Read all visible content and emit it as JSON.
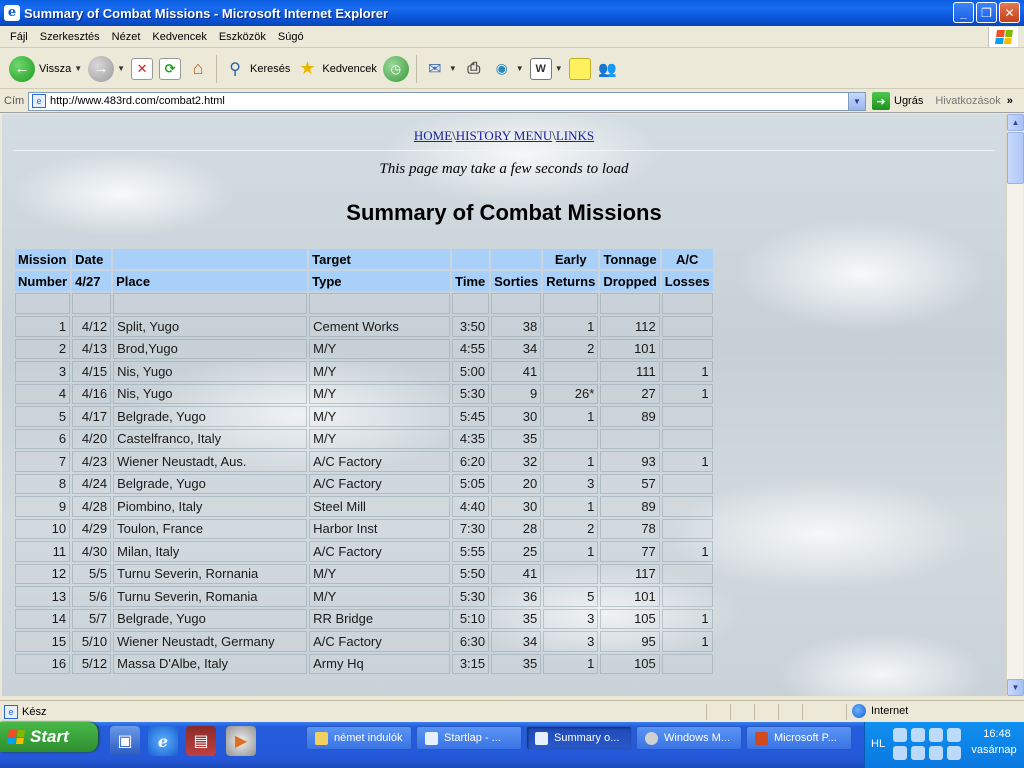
{
  "window": {
    "title": "Summary of Combat Missions - Microsoft Internet Explorer"
  },
  "menu": [
    "Fájl",
    "Szerkesztés",
    "Nézet",
    "Kedvencek",
    "Eszközök",
    "Súgó"
  ],
  "toolbar": {
    "back_label": "Vissza",
    "search_label": "Keresés",
    "favorites_label": "Kedvencek"
  },
  "address": {
    "label": "Cím",
    "url": "http://www.483rd.com/combat2.html",
    "go_label": "Ugrás",
    "links_label": "Hivatkozások"
  },
  "page": {
    "nav": {
      "home": "HOME",
      "history": "HISTORY MENU",
      "links": "LINKS",
      "sep": "\\"
    },
    "load_note": "This page may take a few seconds to load",
    "title": "Summary of Combat Missions",
    "headers_top": [
      "Mission",
      "Date",
      "",
      "Target",
      "",
      "",
      "Early",
      "Tonnage",
      "A/C"
    ],
    "headers_bottom": [
      "Number",
      "4/27",
      "Place",
      "Type",
      "Time",
      "Sorties",
      "Returns",
      "Dropped",
      "Losses"
    ],
    "rows": [
      [
        "1",
        "4/12",
        "Split, Yugo",
        "Cement Works",
        "3:50",
        "38",
        "1",
        "112",
        ""
      ],
      [
        "2",
        "4/13",
        "Brod,Yugo",
        "M/Y",
        "4:55",
        "34",
        "2",
        "101",
        ""
      ],
      [
        "3",
        "4/15",
        "Nis, Yugo",
        "M/Y",
        "5:00",
        "41",
        "",
        "111",
        "1"
      ],
      [
        "4",
        "4/16",
        "Nis, Yugo",
        "M/Y",
        "5:30",
        "9",
        "26*",
        "27",
        "1"
      ],
      [
        "5",
        "4/17",
        "Belgrade, Yugo",
        "M/Y",
        "5:45",
        "30",
        "1",
        "89",
        ""
      ],
      [
        "6",
        "4/20",
        "Castelfranco, Italy",
        "M/Y",
        "4:35",
        "35",
        "",
        "",
        ""
      ],
      [
        "7",
        "4/23",
        "Wiener Neustadt, Aus.",
        "A/C Factory",
        "6:20",
        "32",
        "1",
        "93",
        "1"
      ],
      [
        "8",
        "4/24",
        "Belgrade, Yugo",
        "A/C Factory",
        "5:05",
        "20",
        "3",
        "57",
        ""
      ],
      [
        "9",
        "4/28",
        "Piombino, Italy",
        "Steel Mill",
        "4:40",
        "30",
        "1",
        "89",
        ""
      ],
      [
        "10",
        "4/29",
        "Toulon, France",
        "Harbor Inst",
        "7:30",
        "28",
        "2",
        "78",
        ""
      ],
      [
        "11",
        "4/30",
        "Milan, Italy",
        "A/C Factory",
        "5:55",
        "25",
        "1",
        "77",
        "1"
      ],
      [
        "12",
        "5/5",
        "Turnu Severin, Rornania",
        "M/Y",
        "5:50",
        "41",
        "",
        "117",
        ""
      ],
      [
        "13",
        "5/6",
        "Turnu Severin, Romania",
        "M/Y",
        "5:30",
        "36",
        "5",
        "101",
        ""
      ],
      [
        "14",
        "5/7",
        "Belgrade, Yugo",
        "RR Bridge",
        "5:10",
        "35",
        "3",
        "105",
        "1"
      ],
      [
        "15",
        "5/10",
        "Wiener Neustadt, Germany",
        "A/C Factory",
        "6:30",
        "34",
        "3",
        "95",
        "1"
      ],
      [
        "16",
        "5/12",
        "Massa D'Albe, Italy",
        "Army Hq",
        "3:15",
        "35",
        "1",
        "105",
        ""
      ]
    ]
  },
  "status": {
    "text": "Kész",
    "zone": "Internet"
  },
  "taskbar": {
    "start_label": "Start",
    "tasks": [
      "német indulók",
      "Startlap - ...",
      "Summary o...",
      "Windows M...",
      "Microsoft P..."
    ],
    "lang": "HL",
    "time": "16:48",
    "day": "vasárnap"
  },
  "colors": {
    "header_bg": "#a8d0f8",
    "titlebar": "#0a5ee0",
    "link": "#2020a0"
  }
}
